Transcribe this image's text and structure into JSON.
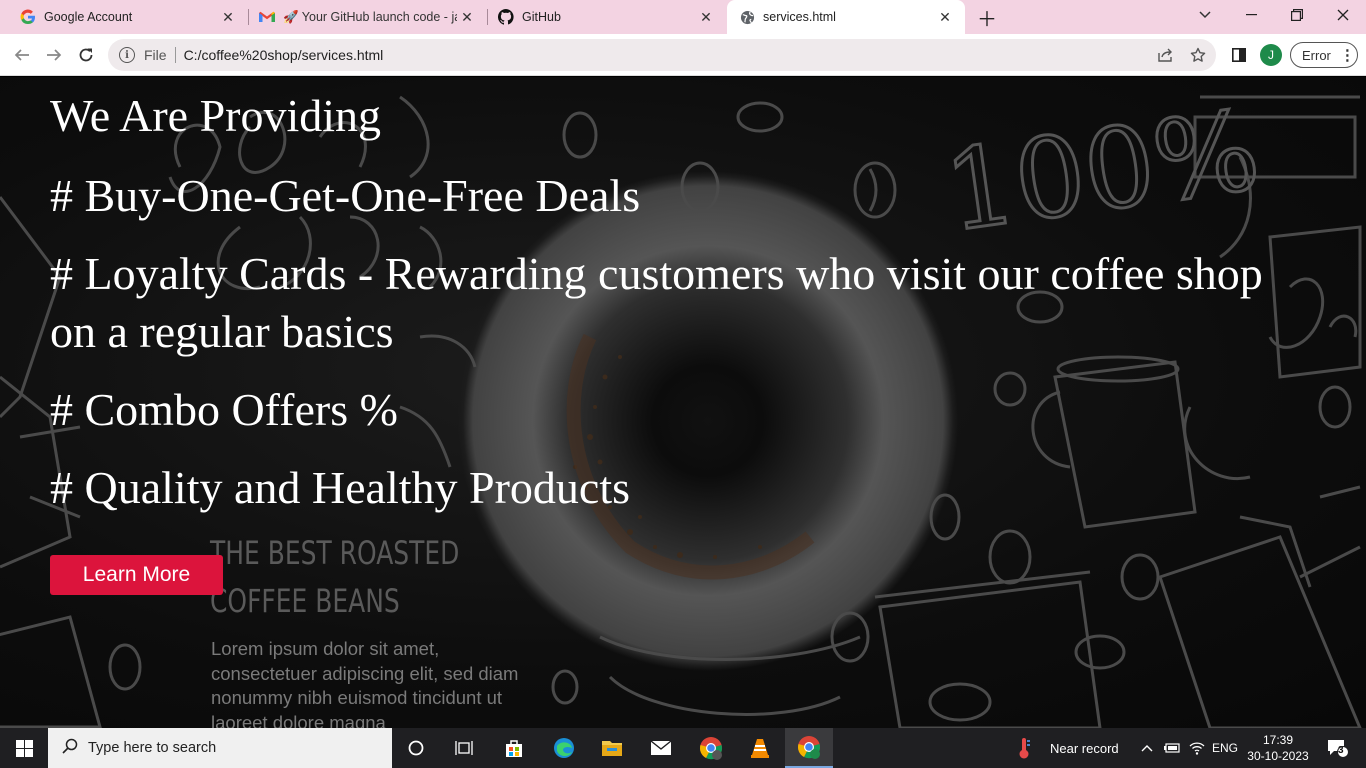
{
  "browser": {
    "tabs": [
      {
        "title": "Google Account",
        "icon": "google-icon"
      },
      {
        "title": "🚀 Your GitHub launch code - ja",
        "icon": "gmail-icon"
      },
      {
        "title": "GitHub",
        "icon": "github-icon"
      },
      {
        "title": "services.html",
        "icon": "globe-icon",
        "active": true
      }
    ],
    "address": {
      "scheme_label": "File",
      "url": "C:/coffee%20shop/services.html"
    },
    "profile_initial": "J",
    "error_label": "Error"
  },
  "page": {
    "heading": "We Are Providing",
    "items": [
      "# Buy-One-Get-One-Free Deals",
      "# Loyalty Cards - Rewarding customers who visit our coffee shop on a regular basics",
      "# Combo Offers %",
      "# Quality and Healthy Products"
    ],
    "button_label": "Learn More",
    "background_art": {
      "headline_line1": "THE BEST ROASTED",
      "headline_line2": "COFFEE BEANS",
      "stamp": "100%",
      "lorem": "Lorem ipsum dolor sit amet, consectetuer adipiscing elit, sed diam nonummy nibh euismod tincidunt ut laoreet dolore magna"
    }
  },
  "taskbar": {
    "search_placeholder": "Type here to search",
    "weather": "Near record",
    "language": "ENG",
    "time": "17:39",
    "date": "30-10-2023",
    "notification_count": "3"
  },
  "colors": {
    "tabstrip": "#f3d3e2",
    "button": "#dc143c",
    "taskbar": "#1f1f22"
  }
}
